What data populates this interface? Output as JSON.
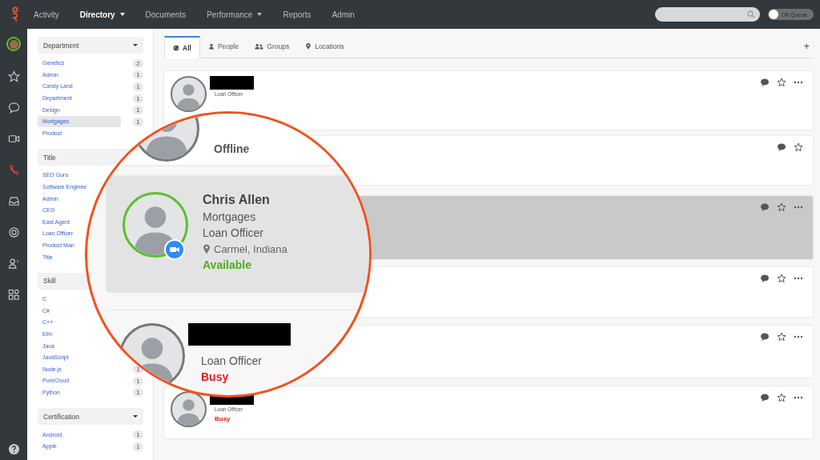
{
  "top_nav": {
    "items": [
      {
        "label": "Activity",
        "selected": false,
        "dropdown": false
      },
      {
        "label": "Directory",
        "selected": true,
        "dropdown": true
      },
      {
        "label": "Documents",
        "selected": false,
        "dropdown": false
      },
      {
        "label": "Performance",
        "selected": false,
        "dropdown": true
      },
      {
        "label": "Reports",
        "selected": false,
        "dropdown": false
      },
      {
        "label": "Admin",
        "selected": false,
        "dropdown": false
      }
    ],
    "queue_toggle": {
      "label": "Off Queue",
      "on": false
    }
  },
  "filters": [
    {
      "title": "Department",
      "dropdown": true,
      "items": [
        {
          "label": "Genetics",
          "count": "2",
          "selected": false
        },
        {
          "label": "Admin",
          "count": "1",
          "selected": false
        },
        {
          "label": "Candy Land",
          "count": "1",
          "selected": false
        },
        {
          "label": "Department",
          "count": "1",
          "selected": false
        },
        {
          "label": "Design",
          "count": "1",
          "selected": false
        },
        {
          "label": "Mortgages",
          "count": "1",
          "selected": true
        },
        {
          "label": "Product",
          "selected": false
        }
      ]
    },
    {
      "title": "Title",
      "items": [
        {
          "label": "SEO Guru",
          "selected": false
        },
        {
          "label": "Software Enginee",
          "selected": false
        },
        {
          "label": "Admin",
          "selected": false
        },
        {
          "label": "CEO",
          "selected": false
        },
        {
          "label": "East Agent",
          "selected": false
        },
        {
          "label": "Loan Officer",
          "selected": false
        },
        {
          "label": "Product Man",
          "selected": false
        },
        {
          "label": "Title",
          "selected": false
        }
      ]
    },
    {
      "title": "Skill",
      "items": [
        {
          "label": "C",
          "selected": false
        },
        {
          "label": "C#",
          "selected": false
        },
        {
          "label": "C++",
          "selected": false
        },
        {
          "label": "Elm",
          "selected": false
        },
        {
          "label": "Java",
          "selected": false
        },
        {
          "label": "JavaScript",
          "selected": false
        },
        {
          "label": "Node.js",
          "count": "1",
          "selected": false
        },
        {
          "label": "PureCloud",
          "count": "1",
          "selected": false
        },
        {
          "label": "Python",
          "count": "1",
          "selected": false
        }
      ]
    },
    {
      "title": "Certification",
      "dropdown": true,
      "items": [
        {
          "label": "Android",
          "count": "1",
          "selected": false
        },
        {
          "label": "Apple",
          "count": "1",
          "selected": false
        }
      ]
    }
  ],
  "tabs": [
    {
      "label": "All",
      "kind": "globe",
      "selected": true
    },
    {
      "label": "People",
      "kind": "person",
      "selected": false
    },
    {
      "label": "Groups",
      "kind": "group",
      "selected": false
    },
    {
      "label": "Locations",
      "kind": "pin",
      "selected": false
    }
  ],
  "add_tab_label": "+",
  "cards": [
    {
      "avatar": true,
      "redacted": true,
      "title": "Loan Officer",
      "selected": false,
      "more": true
    },
    {
      "avatar": false,
      "redacted": false,
      "selected": false,
      "more": false
    },
    {
      "avatar": false,
      "redacted": false,
      "selected": true,
      "more": true
    },
    {
      "avatar": false,
      "redacted": false,
      "selected": false,
      "more": true
    },
    {
      "avatar": false,
      "redacted": false,
      "selected": false,
      "more": true
    },
    {
      "avatar": true,
      "redacted": true,
      "title": "Loan Officer",
      "status": "Busy",
      "color": "#f0141e",
      "selected": false,
      "more": true
    }
  ],
  "magnifier": {
    "cards": [
      {
        "status": "Offline",
        "color": "#555555",
        "selected": false
      },
      {
        "name": "Chris Allen",
        "department": "Mortgages",
        "title": "Loan Officer",
        "location": "Carmel, Indiana",
        "status": "Available",
        "color": "#4caf1e",
        "video": true,
        "selected": true
      },
      {
        "redacted": true,
        "title": "Loan Officer",
        "status": "Busy",
        "color": "#f0141e",
        "selected": false
      }
    ]
  }
}
